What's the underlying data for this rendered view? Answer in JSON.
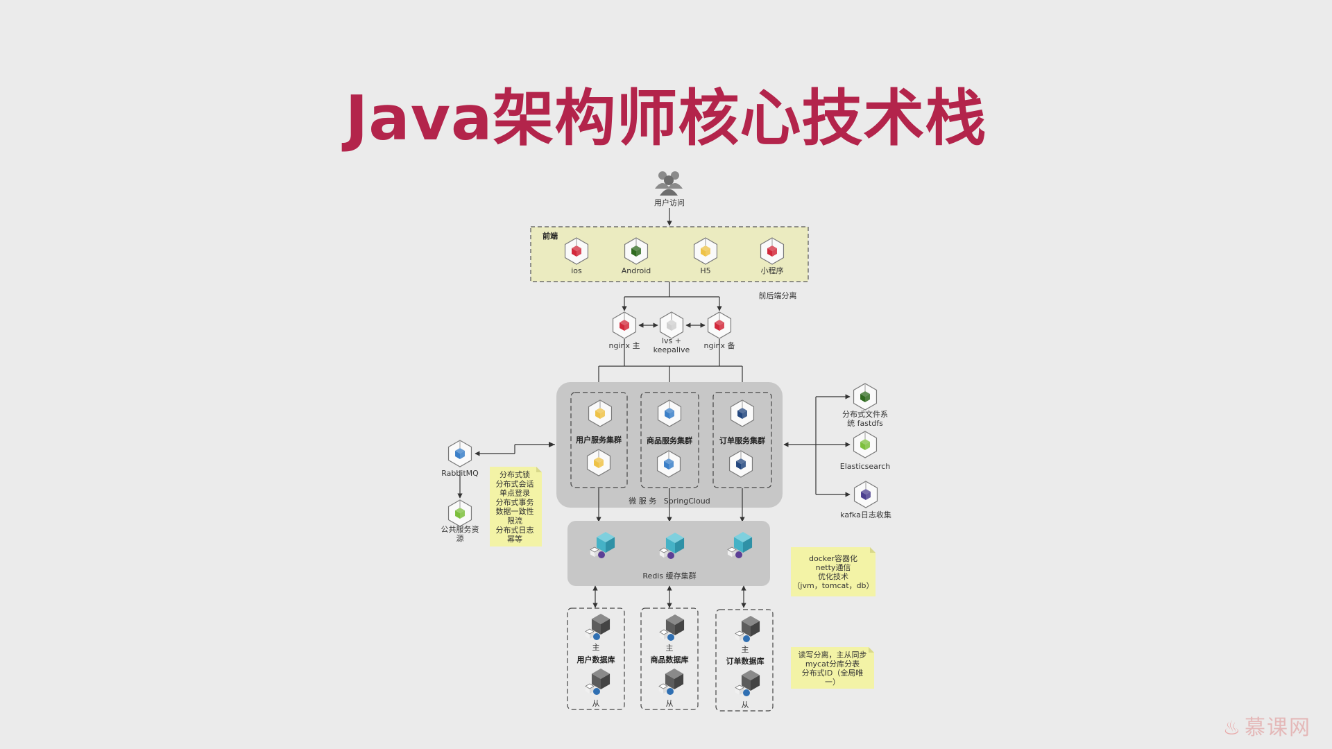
{
  "title": "Java架构师核心技术栈",
  "user_access": "用户访问",
  "frontend": {
    "label": "前端",
    "clients": [
      "ios",
      "Android",
      "H5",
      "小程序"
    ],
    "separation_note": "前后端分离"
  },
  "lb": {
    "nginx_master": "nginx 主",
    "lvs": [
      "lvs +",
      "keepalive"
    ],
    "nginx_backup": "nginx 备"
  },
  "microservices": {
    "clusters": [
      "用户服务集群",
      "商品服务集群",
      "订单服务集群"
    ],
    "caption": "微 服 务   SpringCloud"
  },
  "right_services": {
    "fastdfs": [
      "分布式文件系",
      "统 fastdfs"
    ],
    "elasticsearch": "Elasticsearch",
    "kafka": "kafka日志收集"
  },
  "left_services": {
    "rabbitmq": "RabbitMQ",
    "public_resources": [
      "公共服务资",
      "源"
    ]
  },
  "notes": {
    "distributed": [
      "分布式锁",
      "分布式会话",
      "单点登录",
      "分布式事务",
      "数据一致性",
      "限流",
      "分布式日志",
      "幂等"
    ],
    "docker": [
      "docker容器化",
      "netty通信",
      "优化技术",
      "（jvm，tomcat，db）"
    ],
    "db": [
      "读写分离，主从同步",
      "mycat分库分表",
      "分布式ID（全局唯",
      "一）"
    ]
  },
  "redis": {
    "caption": "Redis 缓存集群"
  },
  "databases": {
    "names": [
      "用户数据库",
      "商品数据库",
      "订单数据库"
    ],
    "master": "主",
    "slave": "从"
  },
  "watermark": "慕课网",
  "colors": {
    "title": "#b3244b",
    "cube_red": "#d2283a",
    "cube_green": "#2f6a1f",
    "cube_yellow": "#eec246",
    "cube_blue": "#3a7fc8",
    "cube_navy": "#22467e",
    "cube_lime": "#7cbf3c",
    "cube_purple": "#4b3f8f",
    "cube_gray": "#cfcfcf",
    "frontend_fill": "#ebebc0",
    "note_fill": "#f3f3a6",
    "panel_fill": "#c7c7c7"
  }
}
